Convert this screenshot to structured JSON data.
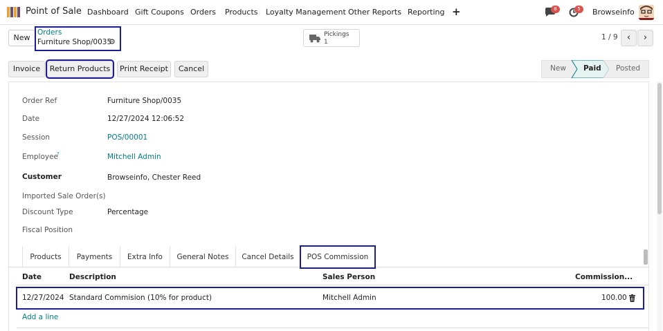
{
  "topnav": {
    "app_name": "Point of Sale",
    "items": [
      "Dashboard",
      "Gift Coupons",
      "Orders",
      "Products",
      "Loyalty Management",
      "Other Reports",
      "Reporting"
    ],
    "messages_count": "8",
    "activities_count": "5",
    "company": "Browseinfo"
  },
  "control": {
    "new_label": "New",
    "breadcrumb_parent": "Orders",
    "breadcrumb_current": "Furniture Shop/0035",
    "pickings_label": "Pickings",
    "pickings_count": "1",
    "pager": "1 / 9"
  },
  "actions": {
    "invoice": "Invoice",
    "return_products": "Return Products",
    "print_receipt": "Print Receipt",
    "cancel": "Cancel"
  },
  "statusbar": {
    "stages": [
      "New",
      "Paid",
      "Posted"
    ],
    "active": "Paid"
  },
  "form": {
    "order_ref_label": "Order Ref",
    "order_ref": "Furniture Shop/0035",
    "date_label": "Date",
    "date": "12/27/2024 12:06:52",
    "session_label": "Session",
    "session": "POS/00001",
    "employee_label": "Employee",
    "employee_help": "?",
    "employee": "Mitchell Admin",
    "customer_label": "Customer",
    "customer": "Browseinfo, Chester Reed",
    "imported_label": "Imported Sale Order(s)",
    "discount_type_label": "Discount Type",
    "discount_type": "Percentage",
    "fiscal_position_label": "Fiscal Position"
  },
  "tabs": [
    "Products",
    "Payments",
    "Extra Info",
    "General Notes",
    "Cancel Details",
    "POS Commission"
  ],
  "active_tab": "POS Commission",
  "table": {
    "headers": [
      "Date",
      "Description",
      "Sales Person",
      "Commission..."
    ],
    "rows": [
      {
        "date": "12/27/2024",
        "description": "Standard Commision (10% for product)",
        "sales_person": "Mitchell Admin",
        "commission": "100.00"
      }
    ],
    "add_line": "Add a line"
  },
  "colors": {
    "accent": "#017e84",
    "highlight": "#1b1b9e",
    "active_stage": "#e6f4f1",
    "brand_purple": "#714b67"
  }
}
